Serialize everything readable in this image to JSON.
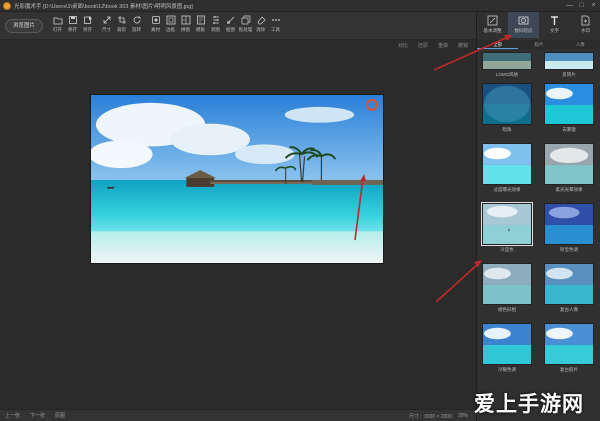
{
  "window": {
    "title": "光影魔术手  [D:\\Users\\1\\桌面\\book\\12\\book 303 素材\\图片\\明明风景图.jpg]",
    "controls": [
      "—",
      "□",
      "×"
    ]
  },
  "toolbar": {
    "open_label": "浏览图片",
    "tools": [
      {
        "label": "打开",
        "icon": "folder-icon"
      },
      {
        "label": "保存",
        "icon": "save-icon"
      },
      {
        "label": "另存",
        "icon": "save-as-icon"
      },
      {
        "label": "尺寸",
        "icon": "resize-icon"
      },
      {
        "label": "裁剪",
        "icon": "crop-icon"
      },
      {
        "label": "旋转",
        "icon": "rotate-icon"
      },
      {
        "label": "素材",
        "icon": "sticker-icon"
      },
      {
        "label": "边框",
        "icon": "frame-icon"
      },
      {
        "label": "拼图",
        "icon": "collage-icon"
      },
      {
        "label": "模板",
        "icon": "template-icon"
      },
      {
        "label": "调图",
        "icon": "adjust-icon"
      },
      {
        "label": "抠图",
        "icon": "cutout-icon"
      },
      {
        "label": "批处理",
        "icon": "batch-icon"
      },
      {
        "label": "消除",
        "icon": "erase-icon"
      },
      {
        "label": "工具",
        "icon": "tools-icon"
      }
    ]
  },
  "subbar": {
    "actions": [
      "对比",
      "还原",
      "重做",
      "撤销"
    ]
  },
  "status": {
    "prev": "上一张",
    "next": "下一张",
    "mode": "原图",
    "size": "尺寸：3000 × 2000",
    "zoom": "30%"
  },
  "watermark_text": "爱上手游网",
  "side_panel": {
    "tabs": [
      {
        "label": "基本调整",
        "icon": "basic-adjust-icon"
      },
      {
        "label": "数码暗房",
        "icon": "darkroom-icon"
      },
      {
        "label": "文字",
        "icon": "text-icon"
      },
      {
        "label": "水印",
        "icon": "watermark-icon"
      }
    ],
    "active_tab": 1,
    "filter_tabs": [
      "全部",
      "胶片",
      "人像"
    ],
    "active_filter": 0,
    "filters": [
      {
        "name": "LOMO风格"
      },
      {
        "name": "反转片"
      },
      {
        "name": "暗角"
      },
      {
        "name": "去雾镜"
      },
      {
        "name": "过度曝光效果"
      },
      {
        "name": "柔光光晕效果"
      },
      {
        "name": "冷蓝色"
      },
      {
        "name": "阿宝色调"
      },
      {
        "name": "褪色旧相"
      },
      {
        "name": "复古人像"
      },
      {
        "name": "冷暖色调"
      },
      {
        "name": "复古胶片"
      }
    ],
    "selected_filter": 6
  },
  "colors": {
    "accent": "#5aa0e0",
    "annotation_arrow": "#c0282a",
    "background": "#2b2b2b"
  }
}
